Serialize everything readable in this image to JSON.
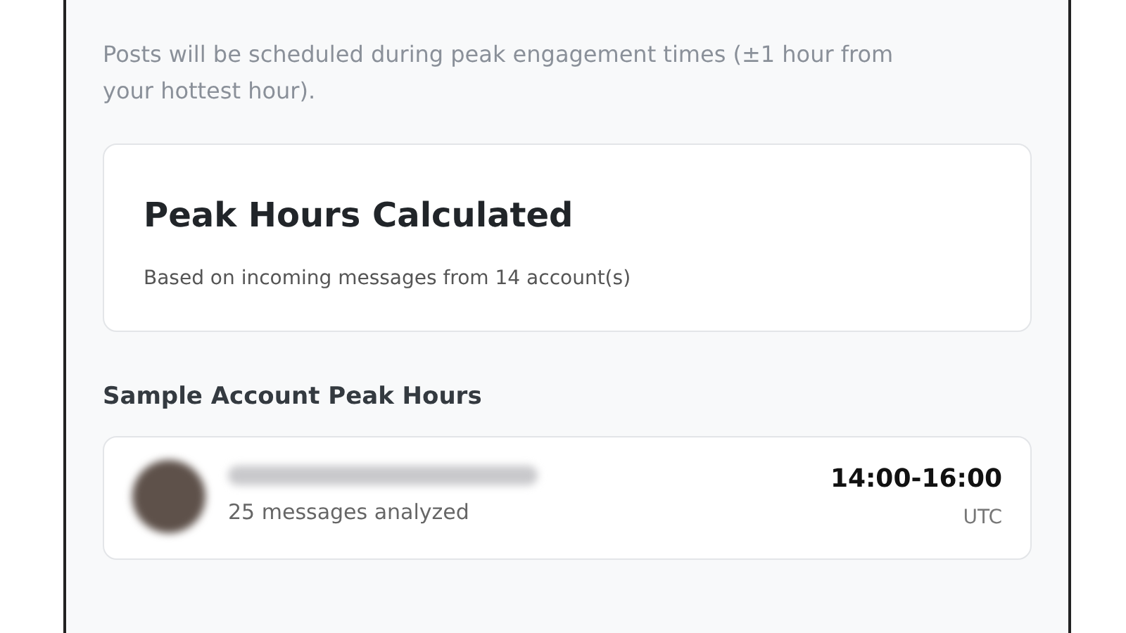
{
  "info_text": "Posts will be scheduled during peak engagement times (±1 hour from your hottest hour).",
  "summary": {
    "title": "Peak Hours Calculated",
    "subtitle": "Based on incoming messages from 14 account(s)"
  },
  "sample_heading": "Sample Account Peak Hours",
  "accounts": [
    {
      "detail": "25 messages analyzed",
      "hours": "14:00-16:00",
      "timezone": "UTC"
    }
  ]
}
